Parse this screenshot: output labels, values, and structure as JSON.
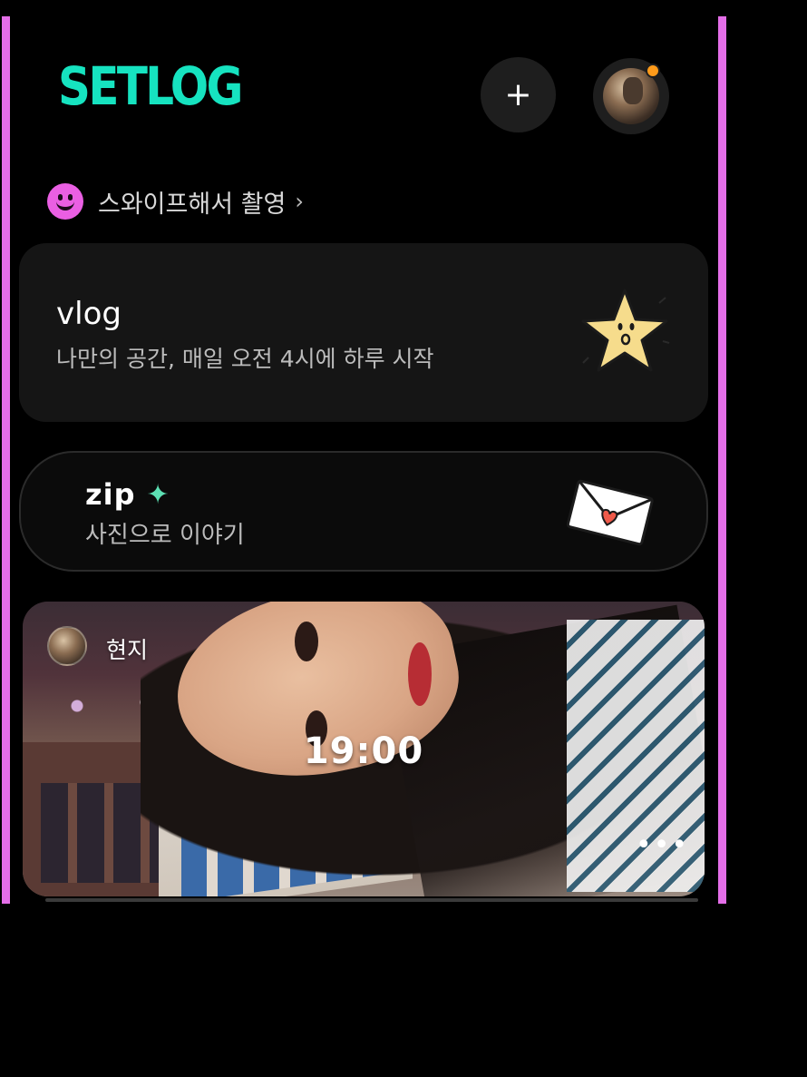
{
  "header": {
    "logo": "SETLOG",
    "add_label": "+",
    "add_icon": "plus-icon",
    "profile_icon": "avatar",
    "notification_color": "#ff9b1a"
  },
  "swipe_hint": {
    "text": "스와이프해서 촬영",
    "chevron": "›",
    "icon": "smiley-icon"
  },
  "vlog_card": {
    "title": "vlog",
    "subtitle": "나만의 공간, 매일 오전 4시에 하루 시작",
    "icon": "star-icon"
  },
  "zip_card": {
    "title": "zip",
    "sparkle": "✦",
    "subtitle": "사진으로 이야기",
    "icon": "letter-icon"
  },
  "post": {
    "author": "현지",
    "time": "19:00",
    "more": "•••"
  },
  "colors": {
    "brand": "#16e3c0",
    "rail": "#e46ee8",
    "smiley": "#ea5fe3",
    "sparkle": "#5de0b4"
  }
}
